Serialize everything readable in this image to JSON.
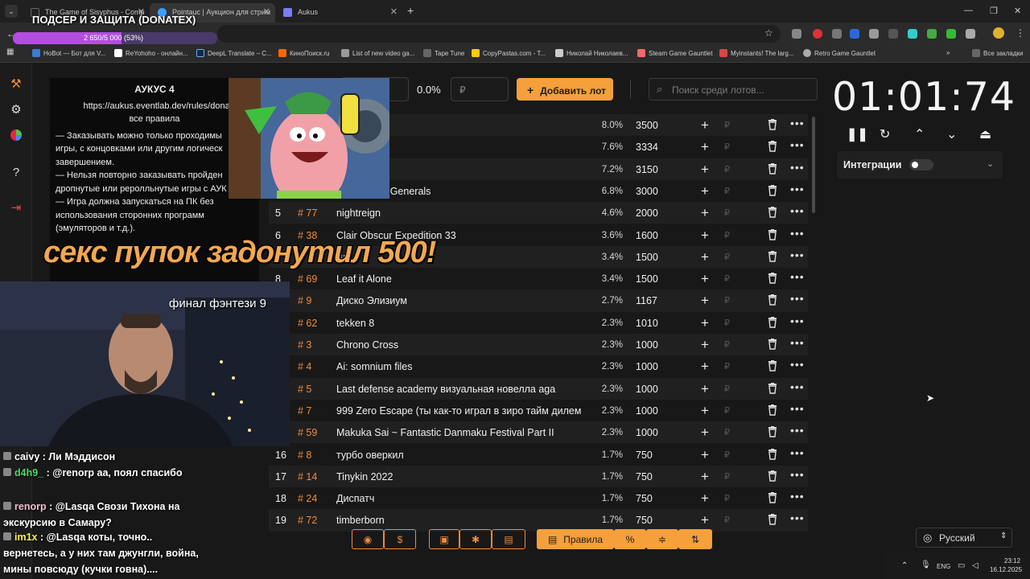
{
  "browser": {
    "tabs": [
      {
        "title": "The Game of Sisyphus - Comp",
        "icon_color": "#222222"
      },
      {
        "title": "Pointauc | Аукцион для стрим",
        "icon_color": "#3aa0ff"
      },
      {
        "title": "Aukus",
        "icon_color": "#7b7bff"
      }
    ],
    "new_tab": "+",
    "bookmarks": [
      {
        "label": "HoBot — Бот для V...",
        "color": "#3a7bd5"
      },
      {
        "label": "ReYohoho - онлайн...",
        "color": "#ffffff"
      },
      {
        "label": "DeepL Translate – С...",
        "color": "#0f2b46"
      },
      {
        "label": "КиноПоиск.ru",
        "color": "#ff6600"
      },
      {
        "label": "List of new video ga...",
        "color": "#999999"
      },
      {
        "label": "Tape Tune",
        "color": "#666666"
      },
      {
        "label": "CopyPastas.com - T...",
        "color": "#ffcc00"
      },
      {
        "label": "Николай Николаев...",
        "color": "#cccccc"
      },
      {
        "label": "Steam Game Gauntlet",
        "color": "#ff6666"
      },
      {
        "label": "Myinstants! The larg...",
        "color": "#d94545"
      },
      {
        "label": "Retro Game Gauntlet",
        "color": "#aaaaaa"
      }
    ],
    "all_bookmarks": "Все закладки"
  },
  "goal": {
    "title": "ПОДСЕР И ЗАЩИТА (DONATEX)",
    "progress_text": "2 650/5 000 (53%)",
    "progress": 0.53
  },
  "rules": {
    "title": "АУКУС 4",
    "link": "https://aukus.eventlab.dev/rules/donator",
    "link_sub": "все правила",
    "items": [
      "— Заказывать можно только проходимы",
      "игры, с концовками или другим логическ",
      "завершением.",
      "— Нельзя повторно заказывать пройден",
      "дропнутые или реролльнутые игры с АУК",
      "— Игра должна запускаться на ПК без",
      "использования сторонних программ",
      "(эмуляторов и т.д.)."
    ]
  },
  "donation_alert": "секс пупок задонутил 500!",
  "webcam_caption": "финал фэнтези 9",
  "controls": {
    "pct_value": "0.0%",
    "currency_placeholder": "₽",
    "add_lot": "Добавить лот",
    "search_placeholder": "Поиск среди лотов..."
  },
  "lots": [
    {
      "rank": "",
      "id": "",
      "name": "y 9",
      "pct": "8.0%",
      "amount": "3500"
    },
    {
      "rank": "",
      "id": "",
      "name": "",
      "pct": "7.6%",
      "amount": "3334"
    },
    {
      "rank": "",
      "id": "",
      "name": "il",
      "pct": "7.2%",
      "amount": "3150"
    },
    {
      "rank": "",
      "id": "",
      "name": "& Conquer: Generals",
      "pct": "6.8%",
      "amount": "3000"
    },
    {
      "rank": "5",
      "id": "# 77",
      "name": "nightreign",
      "pct": "4.6%",
      "amount": "2000"
    },
    {
      "rank": "6",
      "id": "# 38",
      "name": "Clair Obscur Expedition 33",
      "pct": "3.6%",
      "amount": "1600"
    },
    {
      "rank": "",
      "id": "",
      "name": "Br",
      "pct": "3.4%",
      "amount": "1500"
    },
    {
      "rank": "8",
      "id": "# 69",
      "name": "Leaf it Alone",
      "pct": "3.4%",
      "amount": "1500"
    },
    {
      "rank": "",
      "id": "# 9",
      "name": "Диско Элизиум",
      "pct": "2.7%",
      "amount": "1167"
    },
    {
      "rank": "",
      "id": "# 62",
      "name": "tekken 8",
      "pct": "2.3%",
      "amount": "1010"
    },
    {
      "rank": "",
      "id": "# 3",
      "name": "Chrono Cross",
      "pct": "2.3%",
      "amount": "1000"
    },
    {
      "rank": "",
      "id": "# 4",
      "name": "Ai: somnium files",
      "pct": "2.3%",
      "amount": "1000"
    },
    {
      "rank": "",
      "id": "# 5",
      "name": "Last defense academy визуальная новелла aga",
      "pct": "2.3%",
      "amount": "1000"
    },
    {
      "rank": "",
      "id": "# 7",
      "name": "999 Zero Escape (ты как-то играл в зиро тайм дилем",
      "pct": "2.3%",
      "amount": "1000"
    },
    {
      "rank": "",
      "id": "# 59",
      "name": "Makuka Sai ~ Fantastic Danmaku Festival Part II",
      "pct": "2.3%",
      "amount": "1000"
    },
    {
      "rank": "16",
      "id": "# 8",
      "name": "турбо оверкил",
      "pct": "1.7%",
      "amount": "750"
    },
    {
      "rank": "17",
      "id": "# 14",
      "name": "Tinykin 2022",
      "pct": "1.7%",
      "amount": "750"
    },
    {
      "rank": "18",
      "id": "# 24",
      "name": "Диспатч",
      "pct": "1.7%",
      "amount": "750"
    },
    {
      "rank": "19",
      "id": "# 72",
      "name": "timberborn",
      "pct": "1.7%",
      "amount": "750"
    }
  ],
  "timer": "01:01:74",
  "integrations": "Интеграции",
  "bottom": {
    "rules": "Правила"
  },
  "language": "Русский",
  "chat": [
    {
      "user": "caivy",
      "user_color": "#ffffff",
      "text": "Ли Мэддисон"
    },
    {
      "user": "d4h9_",
      "user_color": "#4cd964",
      "text": "@renorp аа, поял спасибо"
    },
    {
      "user": "renorp",
      "user_color": "#f4bfd0",
      "text": "@Lasqa Свози Тихона на"
    },
    {
      "user": "",
      "user_color": "#ffffff",
      "text": "экскурсию в Самару?"
    },
    {
      "user": "im1x",
      "user_color": "#ffee55",
      "text": "@Lasqa коты, точно.."
    },
    {
      "user": "",
      "user_color": "#ffffff",
      "text": "вернетесь, а у них там джунгли, война,"
    },
    {
      "user": "",
      "user_color": "#ffffff",
      "text": "мины повсюду (кучки говна)...."
    }
  ],
  "tray": {
    "lang": "ENG",
    "time": "23:12",
    "date": "16.12.2025"
  },
  "colors": {
    "accent": "#f08a3a",
    "add_button": "#f5a03b",
    "background": "#181818"
  }
}
